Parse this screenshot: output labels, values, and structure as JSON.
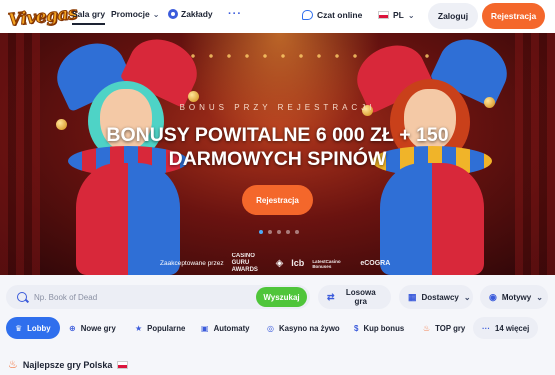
{
  "header": {
    "logo_text": "Vivegas",
    "nav": [
      {
        "label": "Sala gry"
      },
      {
        "label": "Promocje"
      },
      {
        "label": "Zakłady"
      }
    ],
    "more_icon": "more-dots-icon",
    "chat_label": "Czat online",
    "language": "PL",
    "login_label": "Zaloguj",
    "register_label": "Rejestracja"
  },
  "hero": {
    "subtitle": "BONUS PRZY REJESTRACJI",
    "title": "BONUSY POWITALNE 6 000 ZŁ + 150 DARMOWYCH SPINÓW",
    "cta_label": "Rejestracja",
    "slides_total": 5,
    "slide_active": 1,
    "accepted_label": "Zaakceptowane przez",
    "accepted_logos": [
      "CASINO GURU AWARDS",
      "lcb",
      "LatestCasino Bonuses",
      "eCOGRA"
    ]
  },
  "search": {
    "placeholder": "Np. Book of Dead",
    "button_label": "Wyszukaj"
  },
  "filters": [
    {
      "label": "Losowa gra",
      "icon": "shuffle-icon"
    },
    {
      "label": "Dostawcy",
      "icon": "grid-icon"
    },
    {
      "label": "Motywy",
      "icon": "palette-icon"
    }
  ],
  "categories": [
    {
      "label": "Lobby",
      "icon": "lobby-icon"
    },
    {
      "label": "Nowe gry",
      "icon": "plus-icon"
    },
    {
      "label": "Popularne",
      "icon": "star-icon"
    },
    {
      "label": "Automaty",
      "icon": "slot-icon"
    },
    {
      "label": "Kasyno na żywo",
      "icon": "live-icon"
    },
    {
      "label": "Kup bonus",
      "icon": "coin-icon"
    },
    {
      "label": "TOP gry",
      "icon": "fire-icon"
    },
    {
      "label": "14 więcej",
      "icon": "more-dots-icon"
    }
  ],
  "section": {
    "title": "Najlepsze gry Polska"
  },
  "colors": {
    "accent_orange": "#f4672b",
    "accent_blue": "#2f6fed",
    "search_green": "#4fc53a"
  }
}
